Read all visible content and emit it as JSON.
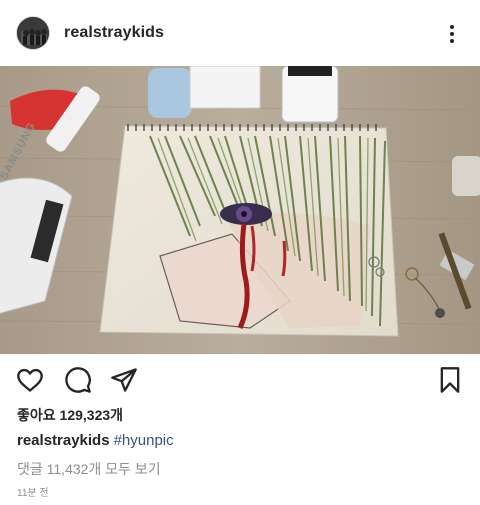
{
  "header": {
    "username": "realstraykids"
  },
  "post": {
    "image_alt": "Illustration sketchbook on wooden desk",
    "brand_text": "SAMSUNG"
  },
  "engagement": {
    "likes_label": "좋아요",
    "likes_count": "129,323개"
  },
  "caption": {
    "username": "realstraykids",
    "hashtag": "#hyunpic"
  },
  "comments": {
    "view_all_label": "댓글 11,432개 모두 보기"
  },
  "timestamp": "11분 전",
  "colors": {
    "text_primary": "#262626",
    "text_secondary": "#8e8e8e",
    "link": "#385185"
  },
  "icons": [
    "more-icon",
    "heart-icon",
    "comment-icon",
    "share-icon",
    "bookmark-icon"
  ]
}
